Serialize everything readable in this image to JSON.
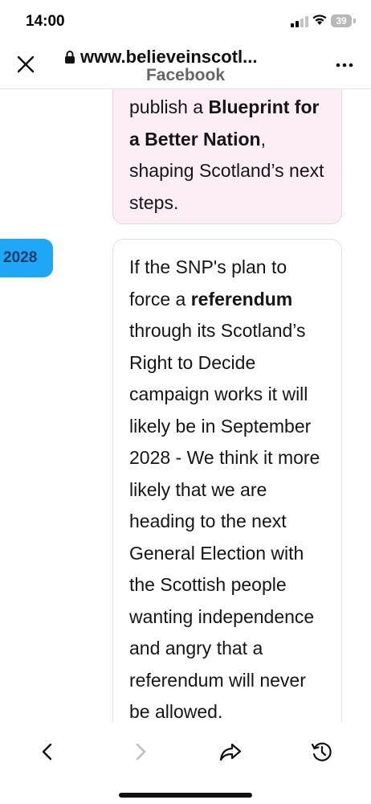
{
  "status_bar": {
    "time": "14:00",
    "battery": "39"
  },
  "browser": {
    "url": "www.believeinscotl...",
    "site_name": "Facebook"
  },
  "content": {
    "card_top": {
      "text_parts": [
        {
          "text": "publish a ",
          "bold": false
        },
        {
          "text": "Blueprint for a Better Nation",
          "bold": true
        },
        {
          "text": ", shaping Scotland’s next steps.",
          "bold": false
        }
      ]
    },
    "timeline_item": {
      "year": "2028",
      "text_parts": [
        {
          "text": "If the SNP's plan to force a ",
          "bold": false
        },
        {
          "text": "referendum",
          "bold": true
        },
        {
          "text": " through its Scotland’s Right to Decide campaign works it will likely be in September 2028 - We think it more likely that we are heading to the next General Election with the Scottish people wanting independence and angry that a referendum will never be allowed.",
          "bold": false
        }
      ]
    }
  },
  "toolbar": {
    "icons": [
      "back-icon",
      "forward-icon",
      "share-icon",
      "history-icon"
    ]
  },
  "colors": {
    "badge": "#1ea7f6",
    "card_pink_bg": "#fdeef5",
    "card_pink_border": "#f0cfdf"
  }
}
